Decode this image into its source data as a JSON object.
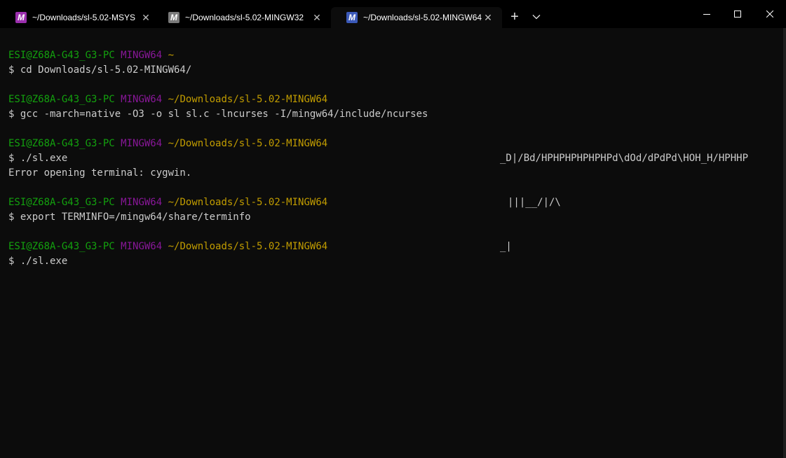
{
  "tabs": [
    {
      "title": "~/Downloads/sl-5.02-MSYS",
      "icon": "msys2-icon",
      "icon_color": "#9b2fae",
      "active": false
    },
    {
      "title": "~/Downloads/sl-5.02-MINGW32",
      "icon": "mingw32-icon",
      "icon_color": "#7a7a7a",
      "active": false
    },
    {
      "title": "~/Downloads/sl-5.02-MINGW64",
      "icon": "mingw64-icon",
      "icon_color": "#3b59b8",
      "active": true
    }
  ],
  "tab_icon_letter": "M",
  "tab_close_glyph": "✕",
  "new_tab_glyph": "+",
  "colors": {
    "user_host": "#13a10e",
    "msystem": "#881798",
    "path": "#c19c00",
    "text": "#cccccc",
    "background": "#0c0c0c"
  },
  "terminal": {
    "prompts": [
      {
        "user": "ESI@Z68A-G43_G3-PC",
        "msystem": "MINGW64",
        "path": "~",
        "command": "$ cd Downloads/sl-5.02-MINGW64/"
      },
      {
        "user": "ESI@Z68A-G43_G3-PC",
        "msystem": "MINGW64",
        "path": "~/Downloads/sl-5.02-MINGW64",
        "command": "$ gcc -march=native -O3 -o sl sl.c -lncurses -I/mingw64/include/ncurses"
      },
      {
        "user": "ESI@Z68A-G43_G3-PC",
        "msystem": "MINGW64",
        "path": "~/Downloads/sl-5.02-MINGW64",
        "command": "$ ./sl.exe"
      },
      {
        "user": "ESI@Z68A-G43_G3-PC",
        "msystem": "MINGW64",
        "path": "~/Downloads/sl-5.02-MINGW64",
        "command": "$ export TERMINFO=/mingw64/share/terminfo"
      },
      {
        "user": "ESI@Z68A-G43_G3-PC",
        "msystem": "MINGW64",
        "path": "~/Downloads/sl-5.02-MINGW64",
        "command": "$ ./sl.exe"
      }
    ],
    "error_output": "Error opening terminal: cygwin.",
    "train_fragments": [
      "_D|/Bd/HPHPHPHPHPHPd\\dOd/dPdPd\\HOH_H/HPHHP",
      "|||__/|/\\",
      "_|"
    ]
  }
}
